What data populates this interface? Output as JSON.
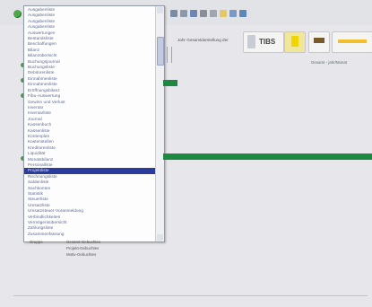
{
  "toolbar": {
    "icons": [
      "go-icon",
      "back-icon",
      "forward-icon",
      "search-icon",
      "print-icon",
      "cut-icon",
      "folder-icon",
      "table-icon",
      "save-icon"
    ]
  },
  "dropdown": {
    "items": [
      "Ausgabenliste",
      "Ausgabenliste",
      "Ausgabenliste",
      "Ausgabenliste",
      "Auswertungen",
      "Bestandsliste",
      "Beschaffungen",
      "Bilanz",
      "Bilanzübersicht",
      "Buchungsjournal",
      "Buchungsliste",
      "Debitorenliste",
      "Einnahmenliste",
      "Einnahmenliste",
      "Eröffnungsbilanz",
      "Fibu-Auswertung",
      "Gewinn und Verlust",
      "Inventar",
      "Inventarliste",
      "Journal",
      "Kassenbuch",
      "Kassenliste",
      "Kontenplan",
      "Kostenstellen",
      "Kreditorenliste",
      "Liquidität",
      "Monatsbilanz",
      "Personalliste",
      "Projektliste",
      "Rechnungsliste",
      "Saldenliste",
      "Sachkonten",
      "Statistik",
      "Steuerliste",
      "Umsatzliste",
      "Umsatzsteuer-Voranmeldung",
      "Verbindlichkeiten",
      "Vermögensübersicht",
      "Zahlungsliste",
      "Zusammenfassung"
    ],
    "selected_index": 28
  },
  "main": {
    "path_label": "Jahr Gesamtdarstellung der",
    "buttons": [
      "TIBS",
      "",
      "",
      ""
    ],
    "hint": "Gesamt - jahr/Monat"
  },
  "footer": {
    "label": "Gruppe",
    "values": [
      "Gesamt-Gebuchtes",
      "Projekt-Gebuchtes",
      "Motiv-Gebuchtes"
    ]
  }
}
